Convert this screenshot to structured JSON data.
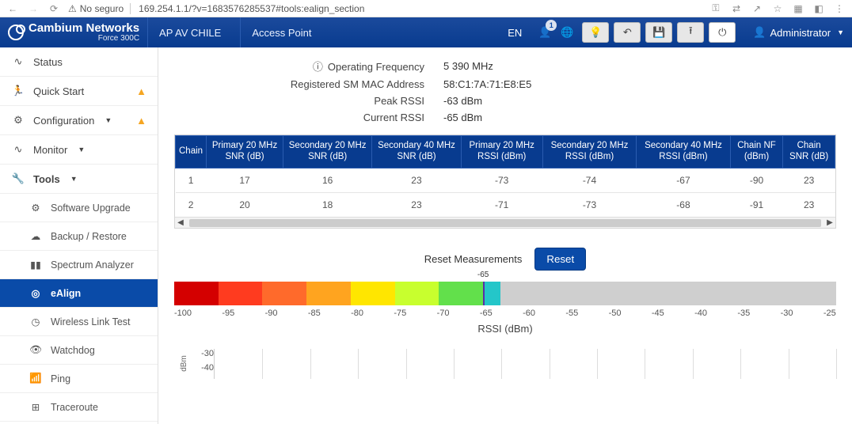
{
  "addressbar": {
    "insecure": "No seguro",
    "url": "169.254.1.1/?v=1683576285537#tools:ealign_section"
  },
  "header": {
    "brand": "Cambium Networks",
    "model": "Force 300C",
    "link1": "AP AV CHILE",
    "link2": "Access Point",
    "lang": "EN",
    "badge": "1",
    "admin": "Administrator"
  },
  "sidebar": {
    "status": "Status",
    "quick": "Quick Start",
    "config": "Configuration",
    "monitor": "Monitor",
    "tools": "Tools",
    "software": "Software Upgrade",
    "backup": "Backup / Restore",
    "spectrum": "Spectrum Analyzer",
    "ealign": "eAlign",
    "wlt": "Wireless Link Test",
    "watchdog": "Watchdog",
    "ping": "Ping",
    "trace": "Traceroute"
  },
  "info": {
    "op_freq_l": "Operating Frequency",
    "op_freq_v": "5 390 MHz",
    "mac_l": "Registered SM MAC Address",
    "mac_v": "58:C1:7A:71:E8:E5",
    "peak_l": "Peak RSSI",
    "peak_v": "-63 dBm",
    "cur_l": "Current RSSI",
    "cur_v": "-65 dBm"
  },
  "table": {
    "h": [
      "Chain",
      "Primary 20 MHz SNR (dB)",
      "Secondary 20 MHz SNR (dB)",
      "Secondary 40 MHz SNR (dB)",
      "Primary 20 MHz RSSI (dBm)",
      "Secondary 20 MHz RSSI (dBm)",
      "Secondary 40 MHz RSSI (dBm)",
      "Chain NF (dBm)",
      "Chain SNR (dB)"
    ],
    "r1": [
      "1",
      "17",
      "16",
      "23",
      "-73",
      "-74",
      "-67",
      "-90",
      "23"
    ],
    "r2": [
      "2",
      "20",
      "18",
      "23",
      "-71",
      "-73",
      "-68",
      "-91",
      "23"
    ]
  },
  "reset": {
    "label": "Reset Measurements",
    "btn": "Reset"
  },
  "chart_data": {
    "type": "bar",
    "title": "RSSI (dBm)",
    "xlabel": "RSSI (dBm)",
    "ylabel": "",
    "current_value": -65,
    "current_label": "-65",
    "range": [
      -100,
      -25
    ],
    "ticks": [
      "-100",
      "-95",
      "-90",
      "-85",
      "-80",
      "-75",
      "-70",
      "-65",
      "-60",
      "-55",
      "-50",
      "-45",
      "-40",
      "-35",
      "-30",
      "-25"
    ],
    "color_segments": [
      {
        "from": -100,
        "to": -95,
        "color": "#d40000"
      },
      {
        "from": -95,
        "to": -90,
        "color": "#ff3b1f"
      },
      {
        "from": -90,
        "to": -85,
        "color": "#ff6a2b"
      },
      {
        "from": -85,
        "to": -80,
        "color": "#ffa41f"
      },
      {
        "from": -80,
        "to": -75,
        "color": "#ffe600"
      },
      {
        "from": -75,
        "to": -70,
        "color": "#c8ff2e"
      },
      {
        "from": -70,
        "to": -65,
        "color": "#62e04b"
      },
      {
        "from": -65,
        "to": -63,
        "color": "#24c6c9"
      },
      {
        "from": -63,
        "to": -25,
        "color": "#cfcfcf"
      }
    ]
  },
  "mini": {
    "ylabel": "dBm",
    "y": [
      "-30",
      "-40"
    ]
  }
}
